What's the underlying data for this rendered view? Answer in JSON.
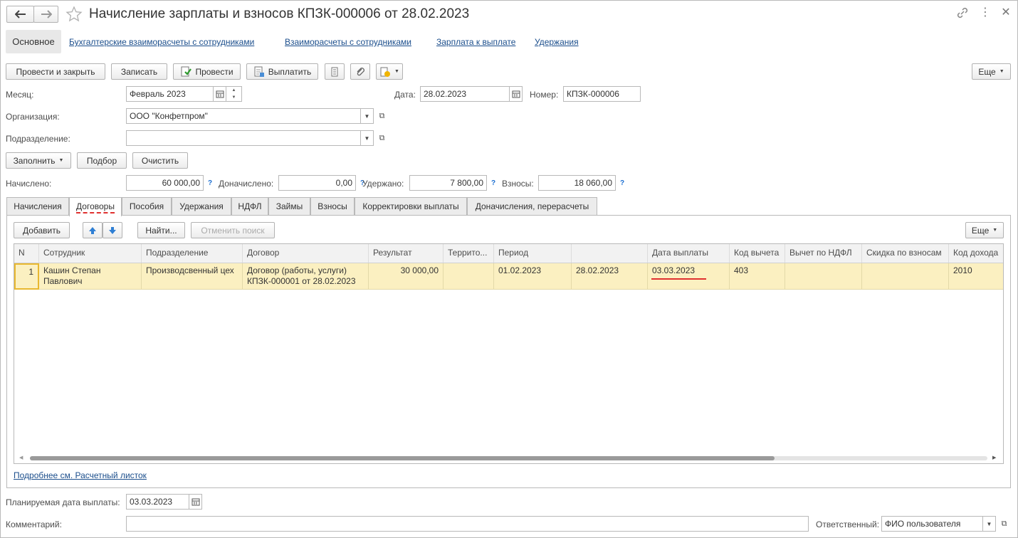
{
  "window": {
    "title": "Начисление зарплаты и взносов КПЗК-000006 от 28.02.2023"
  },
  "nav": {
    "active": "Основное",
    "links": [
      "Бухгалтерские взаиморасчеты с сотрудниками",
      "Взаиморасчеты с сотрудниками",
      "Зарплата к выплате",
      "Удержания"
    ]
  },
  "toolbar": {
    "post_close": "Провести и закрыть",
    "save": "Записать",
    "post": "Провести",
    "pay": "Выплатить",
    "more": "Еще"
  },
  "form": {
    "month_label": "Месяц:",
    "month_value": "Февраль 2023",
    "date_label": "Дата:",
    "date_value": "28.02.2023",
    "number_label": "Номер:",
    "number_value": "КПЗК-000006",
    "org_label": "Организация:",
    "org_value": "ООО \"Конфетпром\"",
    "dept_label": "Подразделение:",
    "dept_value": "",
    "fill_button": "Заполнить",
    "select_button": "Подбор",
    "clear_button": "Очистить"
  },
  "totals": {
    "accrued_label": "Начислено:",
    "accrued_value": "60 000,00",
    "extra_label": "Доначислено:",
    "extra_value": "0,00",
    "withheld_label": "Удержано:",
    "withheld_value": "7 800,00",
    "contrib_label": "Взносы:",
    "contrib_value": "18 060,00",
    "help": "?"
  },
  "tabs": [
    "Начисления",
    "Договоры",
    "Пособия",
    "Удержания",
    "НДФЛ",
    "Займы",
    "Взносы",
    "Корректировки выплаты",
    "Доначисления, перерасчеты"
  ],
  "active_tab": "Договоры",
  "table_toolbar": {
    "add": "Добавить",
    "find": "Найти...",
    "cancel_search": "Отменить поиск",
    "more": "Еще"
  },
  "table": {
    "columns": [
      "N",
      "Сотрудник",
      "Подразделение",
      "Договор",
      "Результат",
      "Террито...",
      "Период",
      "",
      "Дата выплаты",
      "Код вычета",
      "Вычет по НДФЛ",
      "Скидка по взносам",
      "Код дохода"
    ],
    "rows": [
      {
        "n": "1",
        "employee_line1": "Кашин Степан",
        "employee_line2": "Павлович",
        "department": "Производсвенный цех",
        "contract_line1": "Договор (работы, услуги)",
        "contract_line2": "КПЗК-000001 от 28.02.2023",
        "result": "30 000,00",
        "territory": "",
        "period_from": "01.02.2023",
        "period_to": "28.02.2023",
        "pay_date": "03.03.2023",
        "deduction_code": "403",
        "ndfl_deduction": "",
        "contrib_discount": "",
        "income_code": "2010"
      }
    ]
  },
  "details_link": "Подробнее см. Расчетный листок",
  "footer": {
    "planned_label": "Планируемая дата выплаты:",
    "planned_value": "03.03.2023",
    "comment_label": "Комментарий:",
    "comment_value": "",
    "responsible_label": "Ответственный:",
    "responsible_value": "ФИО пользователя"
  },
  "colors": {
    "selected_row": "#fbf0c1",
    "link": "#1b4e8c",
    "underline_red": "#e0302f",
    "help_blue": "#1b6fd1"
  }
}
